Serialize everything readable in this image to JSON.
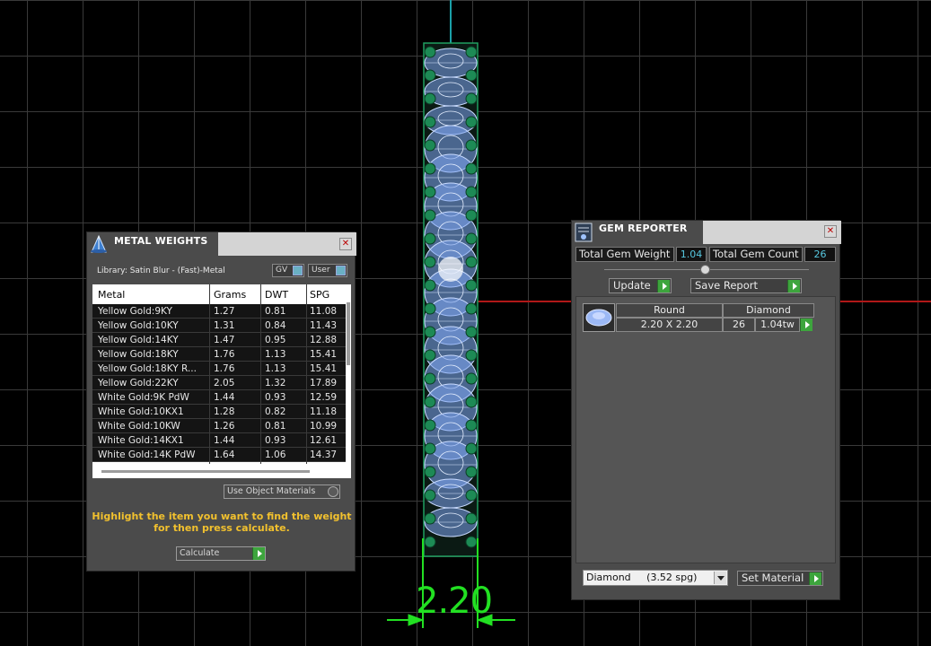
{
  "viewport": {
    "dimension_label": "2.20",
    "colors": {
      "grid": "#3a3a3a",
      "accent_green": "#22e022",
      "gem_blue": "#8fb7ff",
      "prong_green": "#1f8a55"
    }
  },
  "metal_panel": {
    "title": "METAL WEIGHTS",
    "close": "✕",
    "library_label": "Library: Satin Blur - (Fast)-Metal",
    "toggle_gv": "GV",
    "toggle_user": "User",
    "columns": [
      "Metal",
      "Grams",
      "DWT",
      "SPG"
    ],
    "rows": [
      [
        "Yellow Gold:9KY",
        "1.27",
        "0.81",
        "11.08"
      ],
      [
        "Yellow Gold:10KY",
        "1.31",
        "0.84",
        "11.43"
      ],
      [
        "Yellow Gold:14KY",
        "1.47",
        "0.95",
        "12.88"
      ],
      [
        "Yellow Gold:18KY",
        "1.76",
        "1.13",
        "15.41"
      ],
      [
        "Yellow Gold:18KY R...",
        "1.76",
        "1.13",
        "15.41"
      ],
      [
        "Yellow Gold:22KY",
        "2.05",
        "1.32",
        "17.89"
      ],
      [
        "White Gold:9K PdW",
        "1.44",
        "0.93",
        "12.59"
      ],
      [
        "White Gold:10KX1",
        "1.28",
        "0.82",
        "11.18"
      ],
      [
        "White Gold:10KW",
        "1.26",
        "0.81",
        "10.99"
      ],
      [
        "White Gold:14KX1",
        "1.44",
        "0.93",
        "12.61"
      ],
      [
        "White Gold:14K PdW",
        "1.64",
        "1.06",
        "14.37"
      ]
    ],
    "use_object_materials": "Use Object Materials",
    "hint_line1": "Highlight the item you want to find the weight",
    "hint_line2": "for then press calculate.",
    "calculate": "Calculate"
  },
  "gem_panel": {
    "title": "GEM REPORTER",
    "close": "✕",
    "total_weight_label": "Total Gem Weight",
    "total_weight_value": "1.04",
    "total_count_label": "Total Gem Count",
    "total_count_value": "26",
    "update": "Update",
    "save_report": "Save Report",
    "gem": {
      "shape": "Round",
      "material": "Diamond",
      "size": "2.20 X 2.20",
      "count": "26",
      "weight": "1.04tw"
    },
    "material_select": "Diamond     (3.52 spg)",
    "set_material": "Set Material"
  }
}
